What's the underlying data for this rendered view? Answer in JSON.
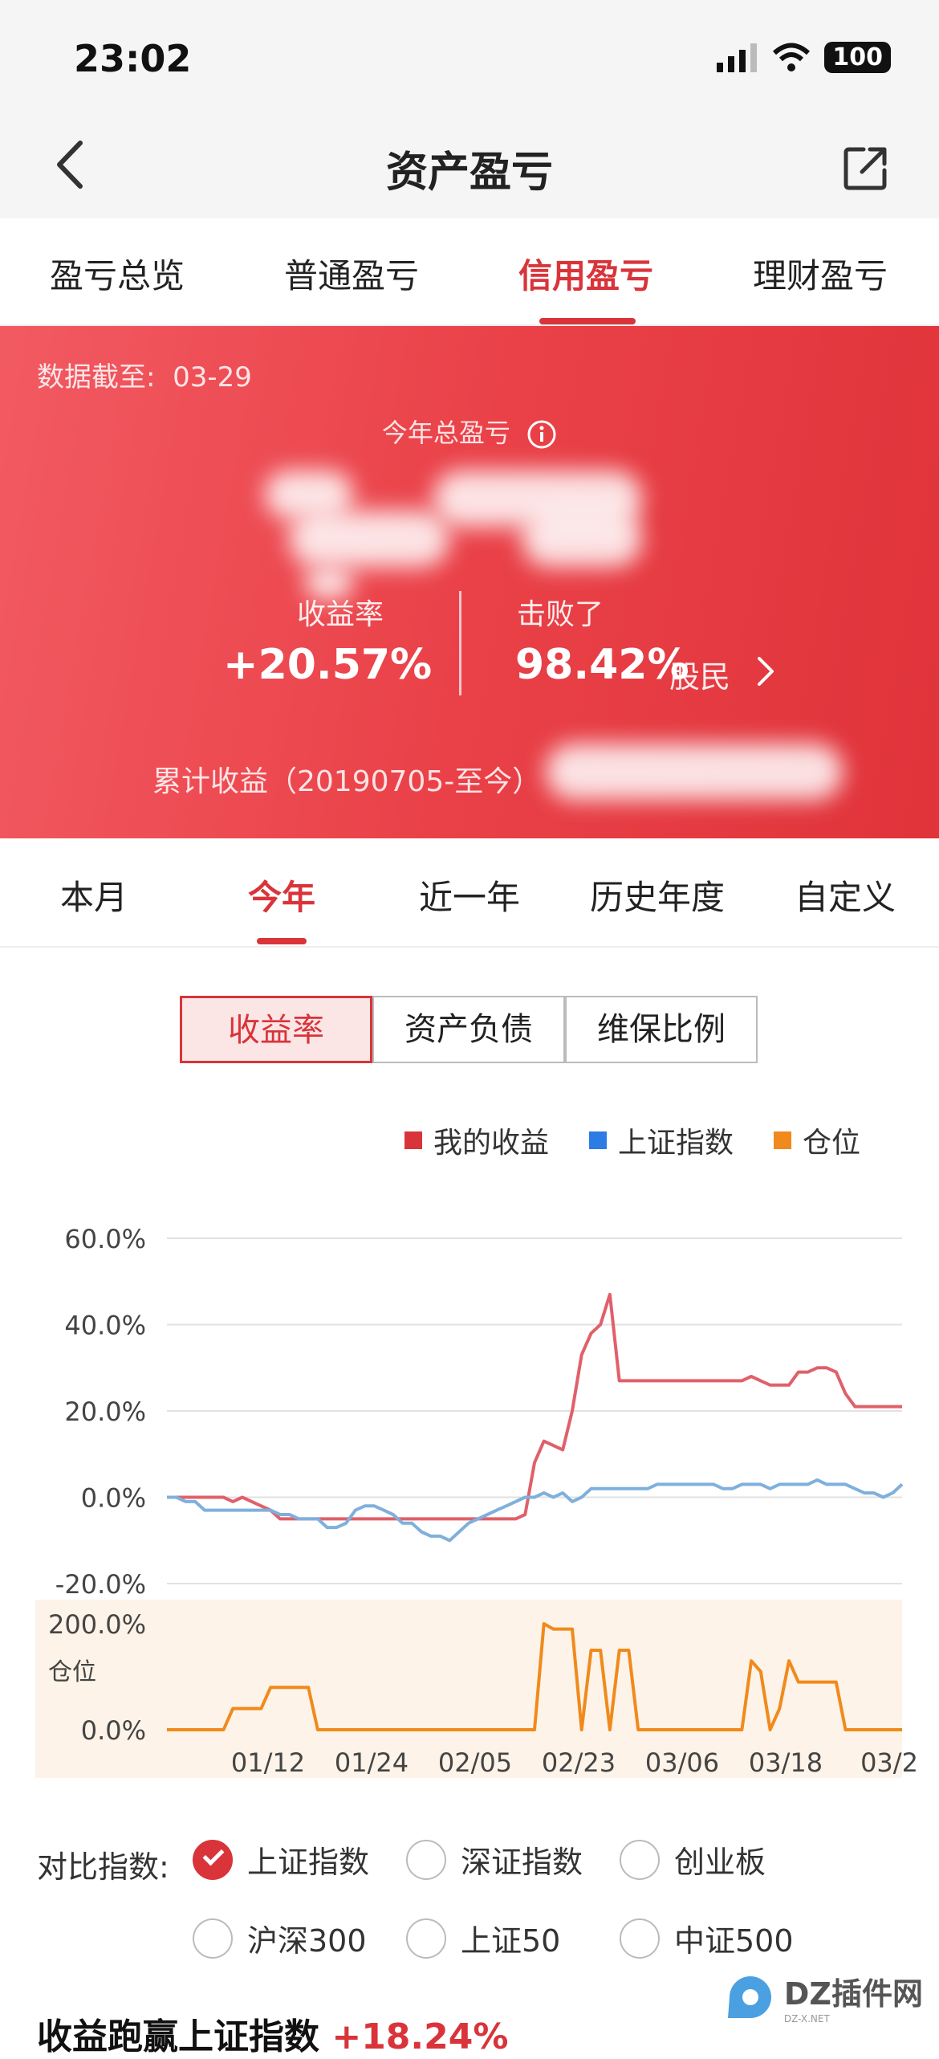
{
  "status": {
    "time": "23:02",
    "battery": "100"
  },
  "header": {
    "title": "资产盈亏"
  },
  "top_tabs": [
    "盈亏总览",
    "普通盈亏",
    "信用盈亏",
    "理财盈亏"
  ],
  "hero": {
    "date_label": "数据截至:",
    "date": "03-29",
    "total_label": "今年总盈亏",
    "rate_label": "收益率",
    "rate": "+20.57%",
    "beat_label": "击败了",
    "beat": "98.42%",
    "beat_unit": "股民",
    "cumulative_label": "累计收益（20190705-至今）"
  },
  "period_tabs": [
    "本月",
    "今年",
    "近一年",
    "历史年度",
    "自定义"
  ],
  "segments": [
    "收益率",
    "资产负债",
    "维保比例"
  ],
  "legend": [
    {
      "name": "我的收益",
      "color": "#d9343a"
    },
    {
      "name": "上证指数",
      "color": "#2d7be5"
    },
    {
      "name": "仓位",
      "color": "#f08a1c"
    }
  ],
  "chart_data": [
    {
      "type": "line",
      "ylim": [
        -20,
        60
      ],
      "ytick_labels": [
        "60.0%",
        "40.0%",
        "20.0%",
        "0.0%",
        "-20.0%"
      ],
      "series": [
        {
          "name": "我的收益",
          "color": "#e0606a",
          "values": [
            0,
            0,
            0,
            0,
            0,
            0,
            0,
            -1,
            0,
            -1,
            -2,
            -3,
            -5,
            -5,
            -5,
            -5,
            -5,
            -5,
            -5,
            -5,
            -5,
            -5,
            -5,
            -5,
            -5,
            -5,
            -5,
            -5,
            -5,
            -5,
            -5,
            -5,
            -5,
            -5,
            -5,
            -5,
            -5,
            -5,
            -4,
            8,
            13,
            12,
            11,
            20,
            33,
            38,
            40,
            47,
            27,
            27,
            27,
            27,
            27,
            27,
            27,
            27,
            27,
            27,
            27,
            27,
            27,
            27,
            28,
            27,
            26,
            26,
            26,
            29,
            29,
            30,
            30,
            29,
            24,
            21,
            21,
            21,
            21,
            21,
            21
          ]
        },
        {
          "name": "上证指数",
          "color": "#7fb0dc",
          "values": [
            0,
            0,
            -1,
            -1,
            -3,
            -3,
            -3,
            -3,
            -3,
            -3,
            -3,
            -3,
            -4,
            -4,
            -5,
            -5,
            -5,
            -7,
            -7,
            -6,
            -3,
            -2,
            -2,
            -3,
            -4,
            -6,
            -6,
            -8,
            -9,
            -9,
            -10,
            -8,
            -6,
            -5,
            -4,
            -3,
            -2,
            -1,
            0,
            0,
            1,
            0,
            1,
            -1,
            0,
            2,
            2,
            2,
            2,
            2,
            2,
            2,
            3,
            3,
            3,
            3,
            3,
            3,
            3,
            2,
            2,
            3,
            3,
            3,
            2,
            3,
            3,
            3,
            3,
            4,
            3,
            3,
            3,
            2,
            1,
            1,
            0,
            1,
            3
          ]
        }
      ]
    },
    {
      "type": "area",
      "ylabel": "仓位",
      "ylim": [
        0,
        200
      ],
      "ytick_labels": [
        "200.0%",
        "0.0%"
      ],
      "x_labels": [
        "01/12",
        "01/24",
        "02/05",
        "02/23",
        "03/06",
        "03/18",
        "03/2"
      ],
      "series": [
        {
          "name": "仓位",
          "color": "#f08a1c",
          "values": [
            0,
            0,
            0,
            0,
            0,
            0,
            0,
            40,
            40,
            40,
            40,
            80,
            80,
            80,
            80,
            80,
            0,
            0,
            0,
            0,
            0,
            0,
            0,
            0,
            0,
            0,
            0,
            0,
            0,
            0,
            0,
            0,
            0,
            0,
            0,
            0,
            0,
            0,
            0,
            0,
            200,
            190,
            190,
            190,
            0,
            150,
            150,
            0,
            150,
            150,
            0,
            0,
            0,
            0,
            0,
            0,
            0,
            0,
            0,
            0,
            0,
            0,
            130,
            110,
            0,
            40,
            130,
            90,
            90,
            90,
            90,
            90,
            0,
            0,
            0,
            0,
            0,
            0,
            0
          ]
        }
      ]
    }
  ],
  "compare": {
    "label": "对比指数:",
    "options": [
      {
        "label": "上证指数",
        "checked": true
      },
      {
        "label": "深证指数",
        "checked": false
      },
      {
        "label": "创业板",
        "checked": false
      },
      {
        "label": "沪深300",
        "checked": false
      },
      {
        "label": "上证50",
        "checked": false
      },
      {
        "label": "中证500",
        "checked": false
      }
    ]
  },
  "bottom": {
    "label": "收益跑赢上证指数",
    "value": "+18.24%"
  },
  "watermark": {
    "text": "DZ插件网",
    "sub": "DZ-X.NET"
  }
}
